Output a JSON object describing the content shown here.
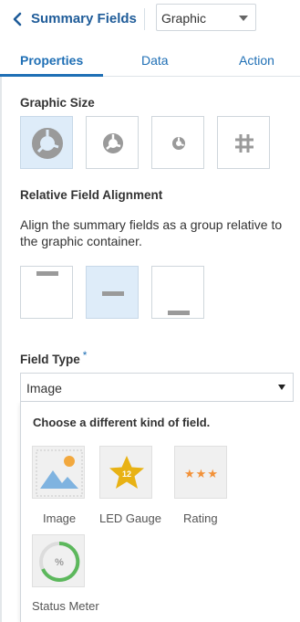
{
  "header": {
    "title": "Summary Fields",
    "select_value": "Graphic"
  },
  "tabs": [
    {
      "label": "Properties",
      "active": true
    },
    {
      "label": "Data",
      "active": false
    },
    {
      "label": "Action",
      "active": false
    }
  ],
  "graphic_size": {
    "label": "Graphic Size",
    "options": [
      "large-ring-icon",
      "medium-ring-icon",
      "small-ring-icon",
      "grid-icon"
    ],
    "selected_index": 0
  },
  "alignment": {
    "label": "Relative Field Alignment",
    "description": "Align the summary fields as a group relative to the graphic container.",
    "options": [
      "align-top-icon",
      "align-middle-icon",
      "align-bottom-icon"
    ],
    "selected_index": 1
  },
  "field_type": {
    "label": "Field Type",
    "required_mark": "*",
    "value": "Image",
    "popup_title": "Choose a different kind of field.",
    "options": [
      {
        "label": "Image",
        "icon": "image-icon"
      },
      {
        "label": "LED Gauge",
        "icon": "star-gauge-icon",
        "icon_text": "12"
      },
      {
        "label": "Rating",
        "icon": "rating-stars-icon",
        "icon_text": "★★★"
      },
      {
        "label": "Status Meter",
        "icon": "status-meter-icon",
        "icon_text": "%"
      }
    ]
  },
  "colors": {
    "accent": "#1f6fb5",
    "title": "#1f5c99",
    "selected_bg": "#deecf9",
    "icon_gray": "#9a9a9a",
    "gauge_gold": "#e8b214",
    "rating_orange": "#f29138",
    "meter_green": "#5cb85c",
    "image_blue": "#7fb3e0"
  }
}
